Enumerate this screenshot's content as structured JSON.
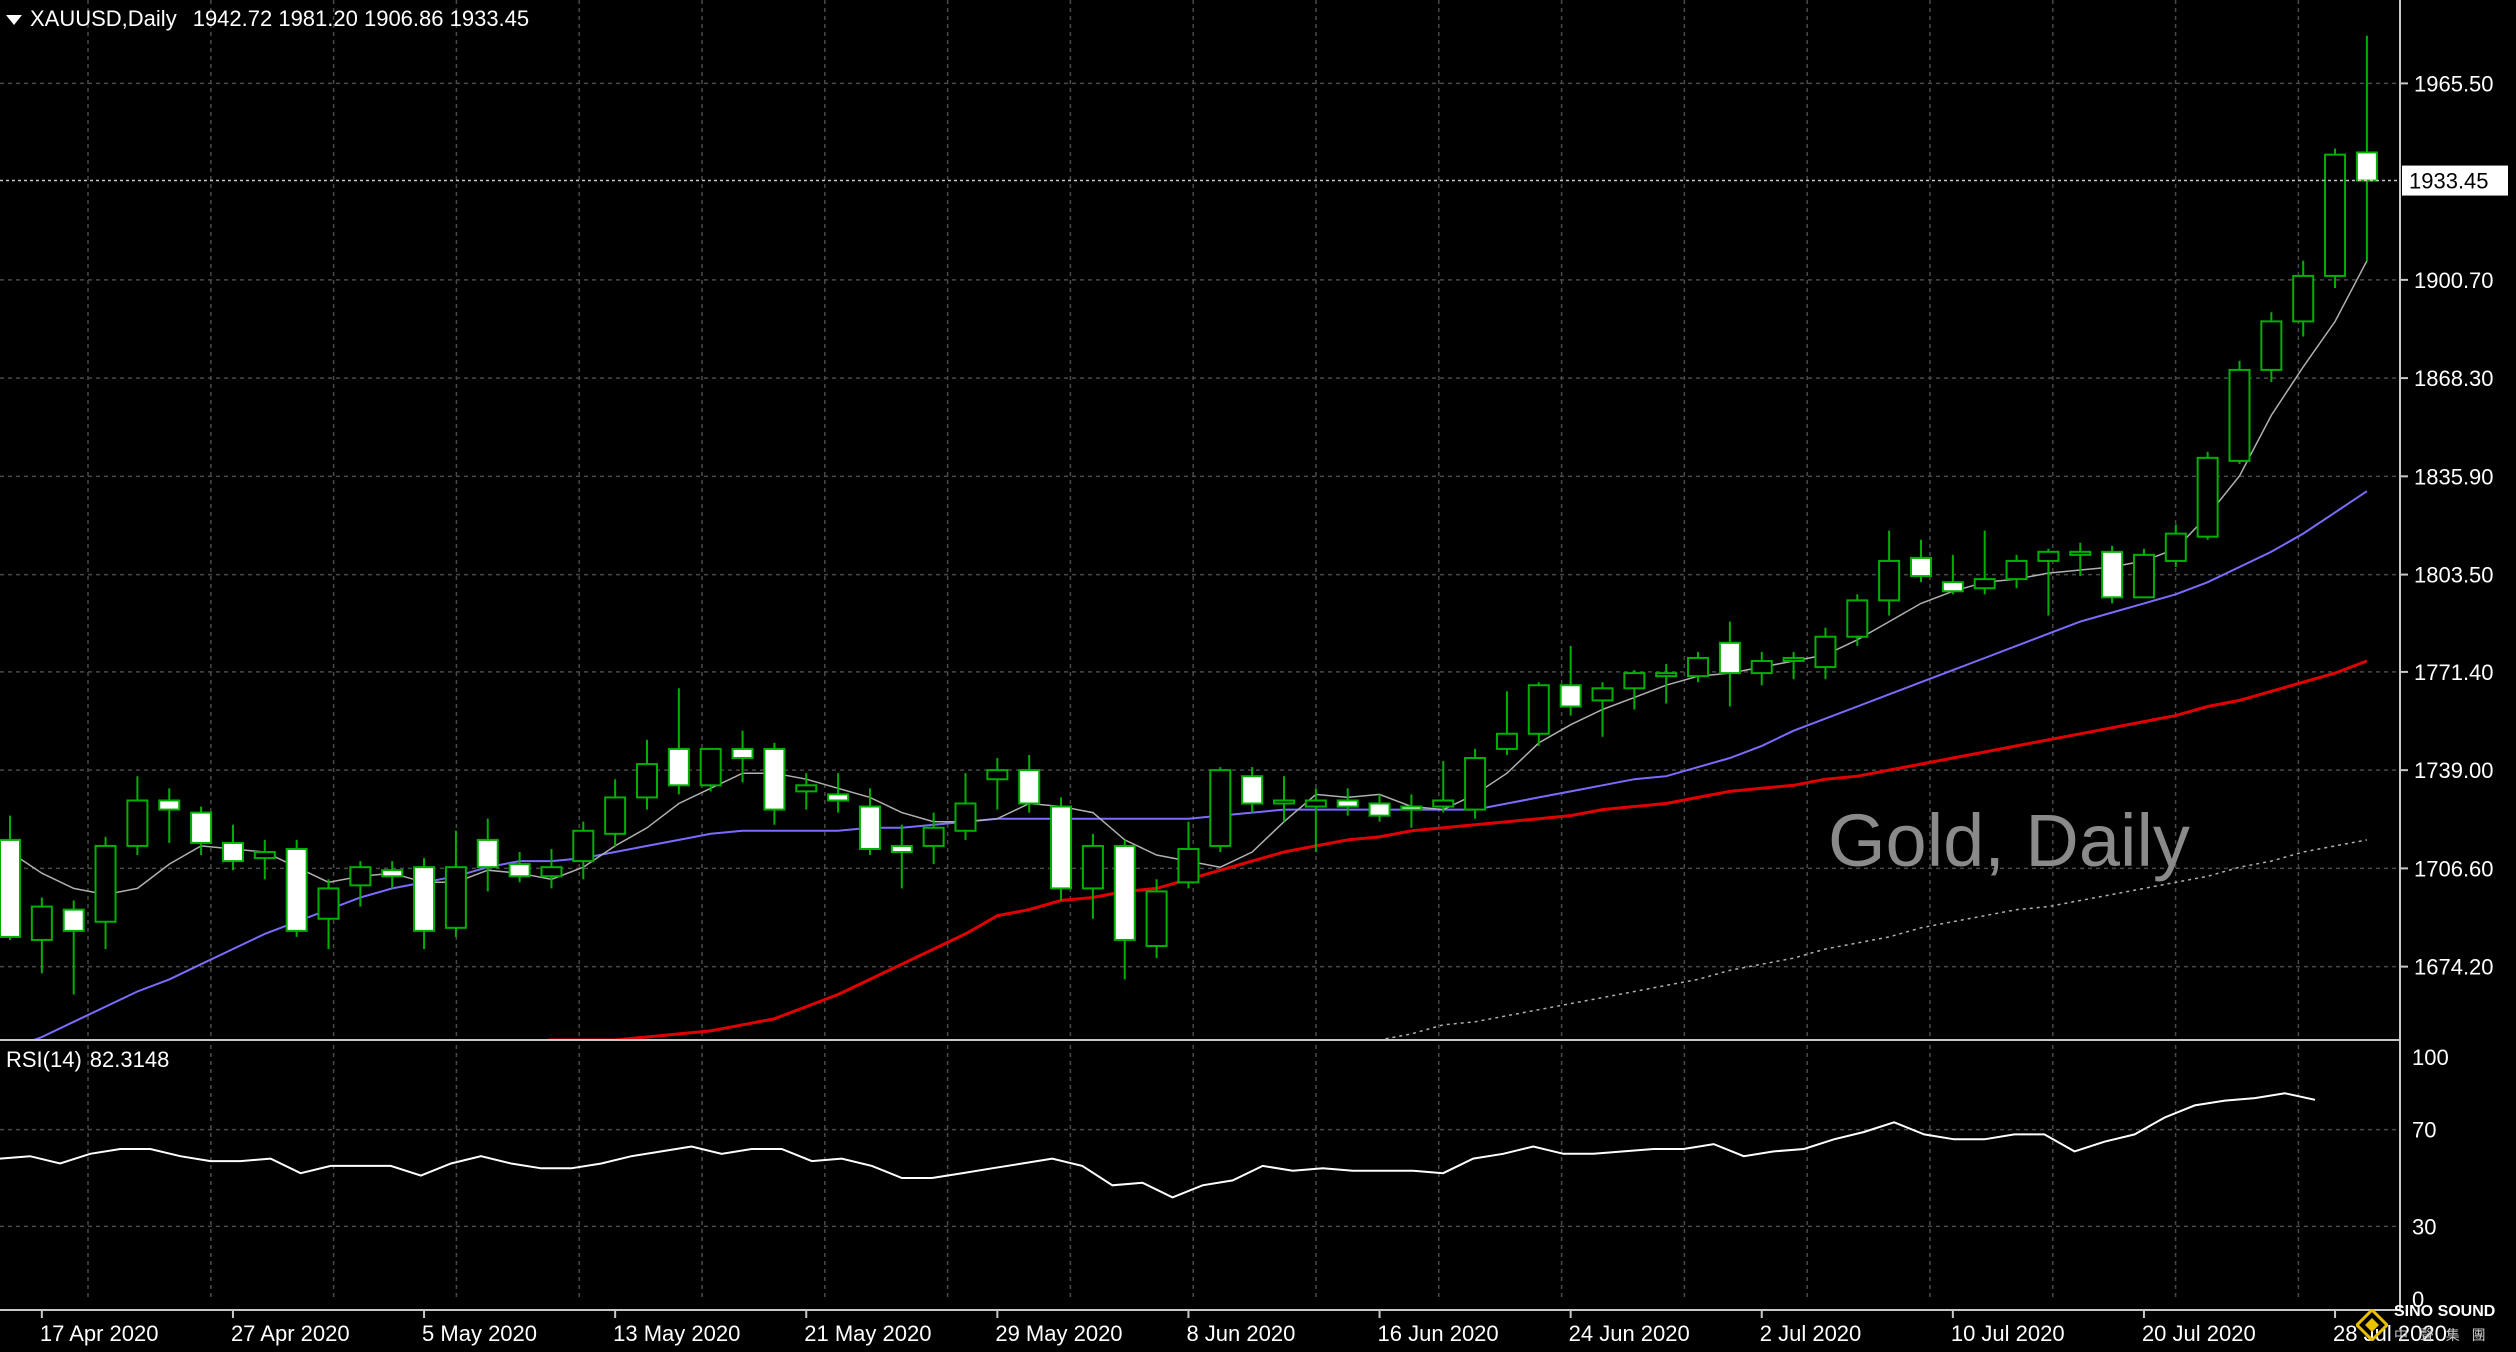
{
  "header": {
    "symbol": "XAUUSD,Daily",
    "ohlc": "1942.72 1981.20 1906.86 1933.45"
  },
  "watermark": {
    "title": "Gold, Daily"
  },
  "logo": {
    "brand": "SINO SOUND",
    "brand_sub": "中 聲 集 團"
  },
  "colors": {
    "background": "#000000",
    "grid": "#4a4a4a",
    "candle_bull_body": "#000000",
    "candle_bull_outline": "#00b000",
    "candle_bear_body": "#ffffff",
    "wick": "#00b000",
    "ma_fast": "#b0b0b0",
    "ma_mid": "#7b6cff",
    "ma_slow": "#e00000",
    "ma_longest": "#b0b0b0",
    "rsi_line": "#ffffff",
    "separator": "#c8c8c8",
    "price_line": "#c8c8c8"
  },
  "chart_data": [
    {
      "type": "candlestick",
      "title": "XAUUSD,Daily",
      "ylim": [
        1650.0,
        1993.0
      ],
      "y_ticks": [
        1965.5,
        1933.45,
        1900.7,
        1868.3,
        1835.9,
        1803.5,
        1771.4,
        1739.0,
        1706.6,
        1674.2
      ],
      "y_tick_labels": [
        "1965.50",
        "1900.70",
        "1868.30",
        "1835.90",
        "1803.50",
        "1771.40",
        "1739.00",
        "1706.60",
        "1674.20"
      ],
      "current_price_label": "1933.45",
      "x_tick_labels": [
        "17 Apr 2020",
        "27 Apr 2020",
        "5 May 2020",
        "13 May 2020",
        "21 May 2020",
        "29 May 2020",
        "8 Jun 2020",
        "16 Jun 2020",
        "24 Jun 2020",
        "2 Jul 2020",
        "10 Jul 2020",
        "20 Jul 2020",
        "28 Jul 2020"
      ],
      "x_tick_index": [
        1,
        7,
        13,
        19,
        25,
        31,
        37,
        43,
        49,
        55,
        61,
        67,
        73
      ],
      "candles": [
        {
          "o": 1716,
          "h": 1724,
          "l": 1683,
          "c": 1684
        },
        {
          "o": 1683,
          "h": 1697,
          "l": 1672,
          "c": 1694
        },
        {
          "o": 1693,
          "h": 1696,
          "l": 1665,
          "c": 1686
        },
        {
          "o": 1689,
          "h": 1717,
          "l": 1680,
          "c": 1714
        },
        {
          "o": 1714,
          "h": 1737,
          "l": 1711,
          "c": 1729
        },
        {
          "o": 1729,
          "h": 1733,
          "l": 1715,
          "c": 1726
        },
        {
          "o": 1725,
          "h": 1727,
          "l": 1711,
          "c": 1715
        },
        {
          "o": 1715,
          "h": 1721,
          "l": 1706,
          "c": 1709
        },
        {
          "o": 1710,
          "h": 1716,
          "l": 1703,
          "c": 1712
        },
        {
          "o": 1713,
          "h": 1716,
          "l": 1684,
          "c": 1686
        },
        {
          "o": 1690,
          "h": 1703,
          "l": 1680,
          "c": 1700
        },
        {
          "o": 1701,
          "h": 1709,
          "l": 1694,
          "c": 1707
        },
        {
          "o": 1706,
          "h": 1709,
          "l": 1700,
          "c": 1704
        },
        {
          "o": 1707,
          "h": 1710,
          "l": 1680,
          "c": 1686
        },
        {
          "o": 1687,
          "h": 1719,
          "l": 1684,
          "c": 1707
        },
        {
          "o": 1716,
          "h": 1723,
          "l": 1699,
          "c": 1707
        },
        {
          "o": 1708,
          "h": 1712,
          "l": 1702,
          "c": 1704
        },
        {
          "o": 1704,
          "h": 1713,
          "l": 1700,
          "c": 1707
        },
        {
          "o": 1709,
          "h": 1722,
          "l": 1703,
          "c": 1719
        },
        {
          "o": 1718,
          "h": 1736,
          "l": 1714,
          "c": 1730
        },
        {
          "o": 1730,
          "h": 1749,
          "l": 1726,
          "c": 1741
        },
        {
          "o": 1746,
          "h": 1766,
          "l": 1731,
          "c": 1734
        },
        {
          "o": 1734,
          "h": 1746,
          "l": 1732,
          "c": 1746
        },
        {
          "o": 1746,
          "h": 1752,
          "l": 1735,
          "c": 1743
        },
        {
          "o": 1746,
          "h": 1748,
          "l": 1721,
          "c": 1726
        },
        {
          "o": 1732,
          "h": 1738,
          "l": 1726,
          "c": 1734
        },
        {
          "o": 1731,
          "h": 1738,
          "l": 1725,
          "c": 1729
        },
        {
          "o": 1727,
          "h": 1733,
          "l": 1711,
          "c": 1713
        },
        {
          "o": 1714,
          "h": 1721,
          "l": 1700,
          "c": 1712
        },
        {
          "o": 1714,
          "h": 1725,
          "l": 1708,
          "c": 1720
        },
        {
          "o": 1719,
          "h": 1738,
          "l": 1716,
          "c": 1728
        },
        {
          "o": 1736,
          "h": 1743,
          "l": 1726,
          "c": 1739
        },
        {
          "o": 1739,
          "h": 1744,
          "l": 1725,
          "c": 1728
        },
        {
          "o": 1727,
          "h": 1730,
          "l": 1696,
          "c": 1700
        },
        {
          "o": 1700,
          "h": 1718,
          "l": 1690,
          "c": 1714
        },
        {
          "o": 1714,
          "h": 1716,
          "l": 1670,
          "c": 1683
        },
        {
          "o": 1681,
          "h": 1703,
          "l": 1677,
          "c": 1699
        },
        {
          "o": 1702,
          "h": 1722,
          "l": 1700,
          "c": 1713
        },
        {
          "o": 1714,
          "h": 1740,
          "l": 1712,
          "c": 1739
        },
        {
          "o": 1737,
          "h": 1740,
          "l": 1725,
          "c": 1728
        },
        {
          "o": 1728,
          "h": 1737,
          "l": 1722,
          "c": 1729
        },
        {
          "o": 1727,
          "h": 1733,
          "l": 1712,
          "c": 1729
        },
        {
          "o": 1729,
          "h": 1733,
          "l": 1724,
          "c": 1727
        },
        {
          "o": 1728,
          "h": 1731,
          "l": 1722,
          "c": 1724
        },
        {
          "o": 1727,
          "h": 1731,
          "l": 1720,
          "c": 1726
        },
        {
          "o": 1727,
          "h": 1742,
          "l": 1725,
          "c": 1729
        },
        {
          "o": 1726,
          "h": 1746,
          "l": 1723,
          "c": 1743
        },
        {
          "o": 1746,
          "h": 1765,
          "l": 1744,
          "c": 1751
        },
        {
          "o": 1751,
          "h": 1768,
          "l": 1747,
          "c": 1767
        },
        {
          "o": 1767,
          "h": 1780,
          "l": 1757,
          "c": 1760
        },
        {
          "o": 1762,
          "h": 1768,
          "l": 1750,
          "c": 1766
        },
        {
          "o": 1766,
          "h": 1772,
          "l": 1759,
          "c": 1771
        },
        {
          "o": 1770,
          "h": 1774,
          "l": 1761,
          "c": 1771
        },
        {
          "o": 1770,
          "h": 1778,
          "l": 1768,
          "c": 1776
        },
        {
          "o": 1781,
          "h": 1788,
          "l": 1760,
          "c": 1771
        },
        {
          "o": 1771,
          "h": 1778,
          "l": 1767,
          "c": 1775
        },
        {
          "o": 1775,
          "h": 1778,
          "l": 1769,
          "c": 1776
        },
        {
          "o": 1773,
          "h": 1786,
          "l": 1769,
          "c": 1783
        },
        {
          "o": 1783,
          "h": 1797,
          "l": 1780,
          "c": 1795
        },
        {
          "o": 1795,
          "h": 1818,
          "l": 1790,
          "c": 1808
        },
        {
          "o": 1809,
          "h": 1815,
          "l": 1801,
          "c": 1803
        },
        {
          "o": 1801,
          "h": 1810,
          "l": 1797,
          "c": 1798
        },
        {
          "o": 1799,
          "h": 1818,
          "l": 1797,
          "c": 1802
        },
        {
          "o": 1802,
          "h": 1810,
          "l": 1799,
          "c": 1808
        },
        {
          "o": 1808,
          "h": 1812,
          "l": 1790,
          "c": 1811
        },
        {
          "o": 1810,
          "h": 1814,
          "l": 1803,
          "c": 1811
        },
        {
          "o": 1811,
          "h": 1813,
          "l": 1794,
          "c": 1796
        },
        {
          "o": 1796,
          "h": 1812,
          "l": 1796,
          "c": 1810
        },
        {
          "o": 1808,
          "h": 1820,
          "l": 1806,
          "c": 1817
        },
        {
          "o": 1816,
          "h": 1844,
          "l": 1815,
          "c": 1842
        },
        {
          "o": 1841,
          "h": 1874,
          "l": 1840,
          "c": 1871
        },
        {
          "o": 1871,
          "h": 1890,
          "l": 1867,
          "c": 1887
        },
        {
          "o": 1887,
          "h": 1907,
          "l": 1882,
          "c": 1902
        },
        {
          "o": 1902,
          "h": 1944,
          "l": 1898,
          "c": 1942
        },
        {
          "o": 1942.72,
          "h": 1981.2,
          "l": 1906.86,
          "c": 1933.45
        }
      ],
      "ma_fast": [
        1712,
        1705,
        1700,
        1698,
        1700,
        1708,
        1714,
        1713,
        1712,
        1707,
        1702,
        1704,
        1705,
        1702,
        1702,
        1706,
        1705,
        1703,
        1707,
        1714,
        1720,
        1728,
        1733,
        1738,
        1738,
        1736,
        1733,
        1730,
        1725,
        1722,
        1722,
        1723,
        1728,
        1727,
        1725,
        1716,
        1711,
        1709,
        1707,
        1712,
        1722,
        1731,
        1730,
        1731,
        1727,
        1726,
        1731,
        1738,
        1748,
        1754,
        1759,
        1763,
        1767,
        1770,
        1771,
        1773,
        1775,
        1777,
        1782,
        1788,
        1794,
        1798,
        1801,
        1802,
        1804,
        1805,
        1806,
        1808,
        1812,
        1823,
        1836,
        1856,
        1872,
        1887,
        1907
      ],
      "ma_mid": [
        1647,
        1651,
        1656,
        1661,
        1666,
        1670,
        1675,
        1680,
        1685,
        1689,
        1693,
        1697,
        1700,
        1702,
        1704,
        1707,
        1709,
        1709,
        1710,
        1712,
        1714,
        1716,
        1718,
        1719,
        1719,
        1719,
        1719,
        1720,
        1720,
        1721,
        1722,
        1723,
        1723,
        1723,
        1723,
        1723,
        1723,
        1723,
        1724,
        1725,
        1726,
        1726,
        1726,
        1726,
        1726,
        1726,
        1726,
        1728,
        1730,
        1732,
        1734,
        1736,
        1737,
        1740,
        1743,
        1747,
        1752,
        1756,
        1760,
        1764,
        1768,
        1772,
        1776,
        1780,
        1784,
        1788,
        1791,
        1794,
        1797,
        1801,
        1806,
        1811,
        1817,
        1824,
        1831
      ],
      "ma_slow": [
        1631,
        1633,
        1634,
        1636,
        1637,
        1639,
        1640,
        1642,
        1643,
        1644,
        1645,
        1646,
        1647,
        1647,
        1648,
        1649,
        1649,
        1650,
        1650,
        1650,
        1651,
        1652,
        1653,
        1655,
        1657,
        1661,
        1665,
        1670,
        1675,
        1680,
        1685,
        1691,
        1693,
        1696,
        1697,
        1699,
        1700,
        1703,
        1706,
        1709,
        1712,
        1714,
        1716,
        1717,
        1719,
        1720,
        1721,
        1722,
        1723,
        1724,
        1726,
        1727,
        1728,
        1730,
        1732,
        1733,
        1734,
        1736,
        1737,
        1739,
        1741,
        1743,
        1745,
        1747,
        1749,
        1751,
        1753,
        1755,
        1757,
        1760,
        1762,
        1765,
        1768,
        1771,
        1775
      ],
      "ma_longest": [
        1630,
        1630,
        1630,
        1630,
        1630,
        1630,
        1630,
        1630,
        1630,
        1630,
        1630,
        1630,
        1630,
        1630,
        1630,
        1630,
        1630,
        1630,
        1630,
        1630,
        1630,
        1630,
        1630,
        1630,
        1630,
        1630,
        1630,
        1630,
        1630,
        1630,
        1630,
        1630,
        1630,
        1630,
        1630,
        1630,
        1630,
        1630,
        1630,
        1630,
        1640,
        1645,
        1647,
        1650,
        1652,
        1655,
        1656,
        1658,
        1660,
        1662,
        1664,
        1666,
        1668,
        1670,
        1673,
        1675,
        1677,
        1680,
        1682,
        1684,
        1687,
        1689,
        1691,
        1693,
        1694,
        1696,
        1698,
        1700,
        1702,
        1704,
        1707,
        1709,
        1712,
        1714,
        1716
      ]
    },
    {
      "type": "line",
      "title": "RSI(14) 82.3148",
      "name": "RSI(14)",
      "value": "82.3148",
      "ylim": [
        0,
        100
      ],
      "y_tick_labels": [
        "100",
        "70",
        "30",
        "0"
      ],
      "y_ticks": [
        100,
        70,
        30,
        0
      ],
      "values": [
        58,
        59,
        56,
        60,
        62,
        62,
        59,
        57,
        57,
        58,
        52,
        55,
        55,
        55,
        51,
        56,
        59,
        56,
        54,
        54,
        56,
        59,
        61,
        63,
        60,
        62,
        62,
        57,
        58,
        55,
        50,
        50,
        52,
        54,
        56,
        58,
        55,
        47,
        48,
        42,
        47,
        49,
        55,
        53,
        54,
        53,
        53,
        53,
        52,
        58,
        60,
        63,
        60,
        60,
        61,
        62,
        62,
        64,
        59,
        61,
        62,
        66,
        69,
        73,
        68,
        66,
        66,
        68,
        68,
        61,
        65,
        68,
        75,
        80,
        82,
        83,
        85,
        82.3148
      ]
    }
  ]
}
